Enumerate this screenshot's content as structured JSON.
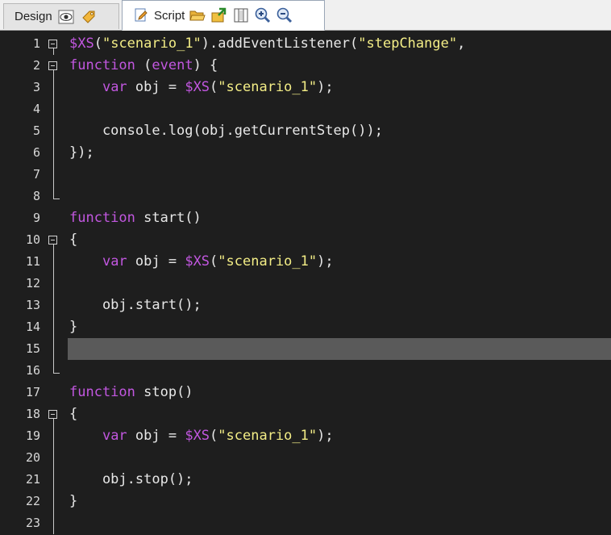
{
  "tabs": {
    "design_label": "Design",
    "script_label": "Script"
  },
  "toolbar": {
    "design_icons": [
      "preview-eye-icon",
      "tag-icon"
    ],
    "script_icons": [
      "script-icon",
      "open-folder-icon",
      "export-icon",
      "columns-icon",
      "zoom-in-icon",
      "zoom-out-icon"
    ]
  },
  "editor": {
    "current_line": 15,
    "lines": [
      {
        "n": "1",
        "fold": "open",
        "tokens": [
          [
            "xs",
            "$XS"
          ],
          [
            "pl",
            "("
          ],
          [
            "str",
            "\"scenario_1\""
          ],
          [
            "pl",
            ").addEventListener("
          ],
          [
            "str",
            "\"stepChange\""
          ],
          [
            "pl",
            ","
          ]
        ]
      },
      {
        "n": "2",
        "fold": "open",
        "tokens": [
          [
            "kw",
            "function"
          ],
          [
            "pl",
            " ("
          ],
          [
            "kw",
            "event"
          ],
          [
            "pl",
            ") {"
          ]
        ]
      },
      {
        "n": "3",
        "fold": "line",
        "tokens": [
          [
            "pl",
            "    "
          ],
          [
            "kw",
            "var"
          ],
          [
            "pl",
            " obj = "
          ],
          [
            "xs",
            "$XS"
          ],
          [
            "pl",
            "("
          ],
          [
            "str",
            "\"scenario_1\""
          ],
          [
            "pl",
            ");"
          ]
        ]
      },
      {
        "n": "4",
        "fold": "line",
        "tokens": []
      },
      {
        "n": "5",
        "fold": "line",
        "tokens": [
          [
            "pl",
            "    console.log(obj.getCurrentStep());"
          ]
        ]
      },
      {
        "n": "6",
        "fold": "line",
        "tokens": [
          [
            "pl",
            "});"
          ]
        ]
      },
      {
        "n": "7",
        "fold": "line",
        "tokens": []
      },
      {
        "n": "8",
        "fold": "end",
        "tokens": []
      },
      {
        "n": "9",
        "fold": "none",
        "tokens": [
          [
            "kw",
            "function"
          ],
          [
            "pl",
            " start()"
          ]
        ]
      },
      {
        "n": "10",
        "fold": "open",
        "tokens": [
          [
            "pl",
            "{"
          ]
        ]
      },
      {
        "n": "11",
        "fold": "line",
        "tokens": [
          [
            "pl",
            "    "
          ],
          [
            "kw",
            "var"
          ],
          [
            "pl",
            " obj = "
          ],
          [
            "xs",
            "$XS"
          ],
          [
            "pl",
            "("
          ],
          [
            "str",
            "\"scenario_1\""
          ],
          [
            "pl",
            ");"
          ]
        ]
      },
      {
        "n": "12",
        "fold": "line",
        "tokens": []
      },
      {
        "n": "13",
        "fold": "line",
        "tokens": [
          [
            "pl",
            "    obj.start();"
          ]
        ]
      },
      {
        "n": "14",
        "fold": "line",
        "tokens": [
          [
            "pl",
            "}"
          ]
        ]
      },
      {
        "n": "15",
        "fold": "line",
        "tokens": []
      },
      {
        "n": "16",
        "fold": "end",
        "tokens": []
      },
      {
        "n": "17",
        "fold": "none",
        "tokens": [
          [
            "kw",
            "function"
          ],
          [
            "pl",
            " stop()"
          ]
        ]
      },
      {
        "n": "18",
        "fold": "open",
        "tokens": [
          [
            "pl",
            "{"
          ]
        ]
      },
      {
        "n": "19",
        "fold": "line",
        "tokens": [
          [
            "pl",
            "    "
          ],
          [
            "kw",
            "var"
          ],
          [
            "pl",
            " obj = "
          ],
          [
            "xs",
            "$XS"
          ],
          [
            "pl",
            "("
          ],
          [
            "str",
            "\"scenario_1\""
          ],
          [
            "pl",
            ");"
          ]
        ]
      },
      {
        "n": "20",
        "fold": "line",
        "tokens": []
      },
      {
        "n": "21",
        "fold": "line",
        "tokens": [
          [
            "pl",
            "    obj.stop();"
          ]
        ]
      },
      {
        "n": "22",
        "fold": "line",
        "tokens": [
          [
            "pl",
            "}"
          ]
        ]
      },
      {
        "n": "23",
        "fold": "line",
        "tokens": []
      }
    ]
  }
}
